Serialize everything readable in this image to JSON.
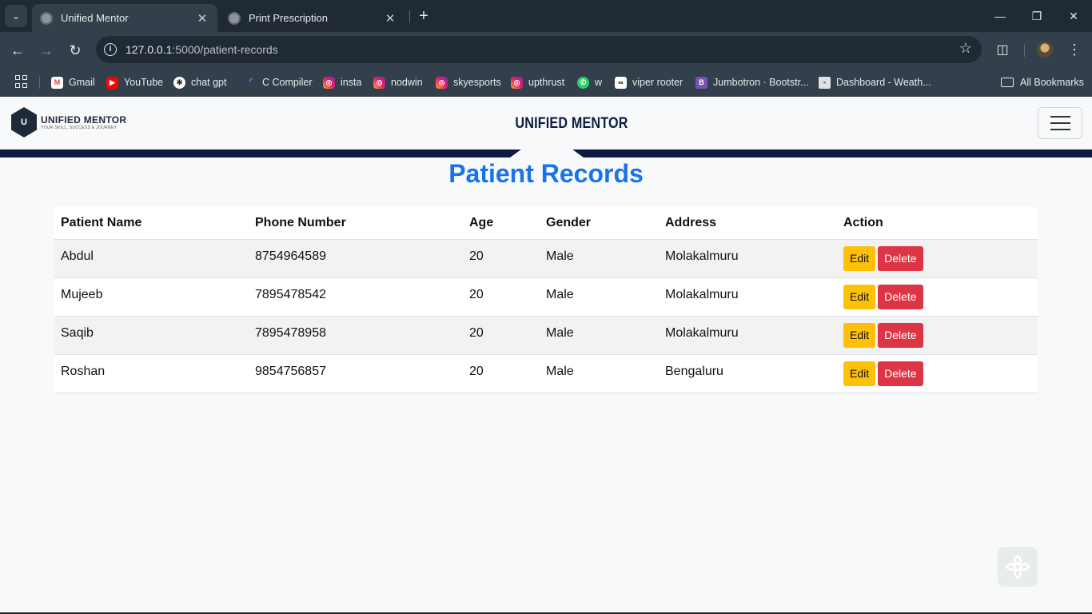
{
  "browser": {
    "tabs": [
      {
        "title": "Unified Mentor",
        "active": true
      },
      {
        "title": "Print Prescription",
        "active": false
      }
    ],
    "url_host": "127.0.0.1",
    "url_path": ":5000/patient-records",
    "bookmarks": [
      {
        "label": "Gmail",
        "icon": "gmail-icon"
      },
      {
        "label": "YouTube",
        "icon": "youtube-icon"
      },
      {
        "label": "chat gpt",
        "icon": "chatgpt-icon"
      },
      {
        "label": "C Compiler",
        "icon": "compiler-icon"
      },
      {
        "label": "insta",
        "icon": "instagram-icon"
      },
      {
        "label": "nodwin",
        "icon": "instagram-icon"
      },
      {
        "label": "skyesports",
        "icon": "instagram-icon"
      },
      {
        "label": "upthrust",
        "icon": "instagram-icon"
      },
      {
        "label": "w",
        "icon": "whatsapp-icon"
      },
      {
        "label": "viper rooter",
        "icon": "link-icon"
      },
      {
        "label": "Jumbotron · Bootstr...",
        "icon": "bootstrap-icon"
      },
      {
        "label": "Dashboard - Weath...",
        "icon": "page-icon"
      }
    ],
    "all_bookmarks_label": "All Bookmarks"
  },
  "navbar": {
    "logo_name": "UNIFIED MENTOR",
    "logo_tagline": "YOUR SKILL, SUCCESS & JOURNEY",
    "brand_title": "UNIFIED MENTOR"
  },
  "main": {
    "title": "Patient Records",
    "columns": [
      "Patient Name",
      "Phone Number",
      "Age",
      "Gender",
      "Address",
      "Action"
    ],
    "rows": [
      {
        "name": "Abdul",
        "phone": "8754964589",
        "age": "20",
        "gender": "Male",
        "address": "Molakalmuru"
      },
      {
        "name": "Mujeeb",
        "phone": "7895478542",
        "age": "20",
        "gender": "Male",
        "address": "Molakalmuru"
      },
      {
        "name": "Saqib",
        "phone": "7895478958",
        "age": "20",
        "gender": "Male",
        "address": "Molakalmuru"
      },
      {
        "name": "Roshan",
        "phone": "9854756857",
        "age": "20",
        "gender": "Male",
        "address": "Bengaluru"
      }
    ],
    "edit_label": "Edit",
    "delete_label": "Delete"
  },
  "colors": {
    "title_blue": "#1a73e8",
    "edit_yellow": "#ffc107",
    "delete_red": "#dc3545",
    "navy": "#0d1b3e"
  }
}
